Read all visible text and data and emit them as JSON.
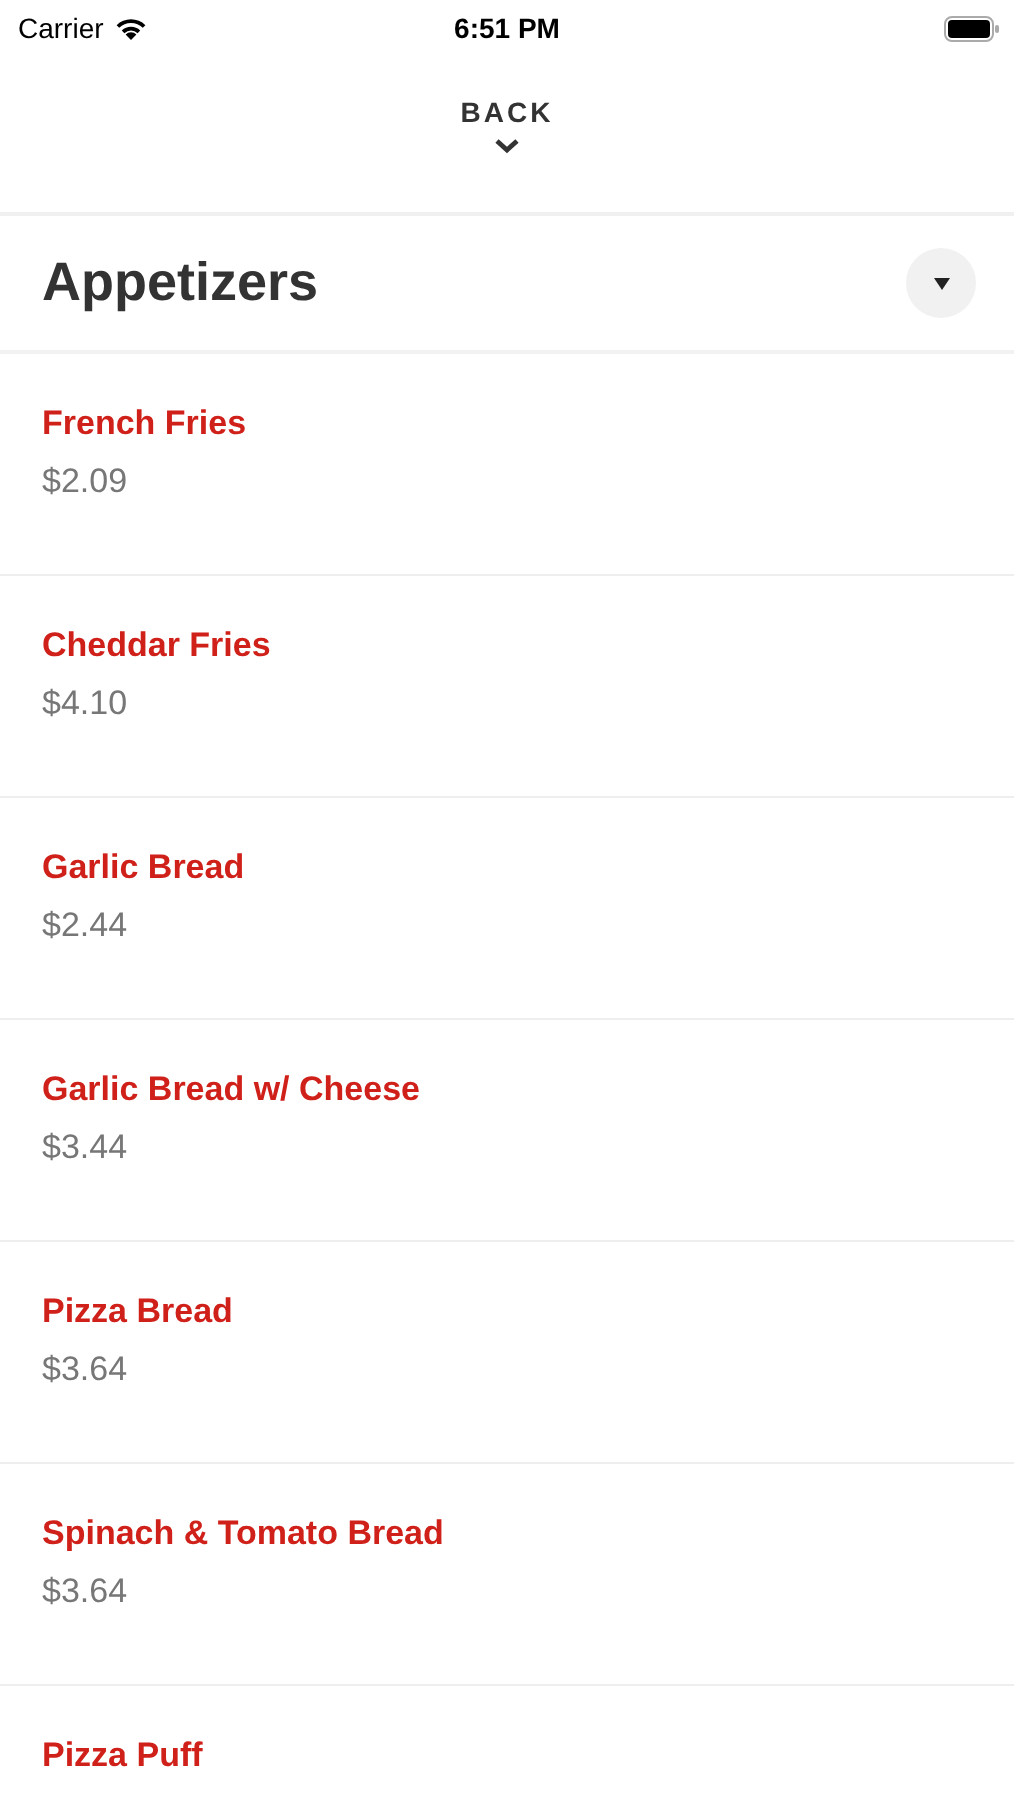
{
  "status_bar": {
    "carrier": "Carrier",
    "time": "6:51 PM"
  },
  "nav": {
    "back_label": "BACK"
  },
  "section": {
    "title": "Appetizers",
    "expanded": true
  },
  "items": [
    {
      "name": "French Fries",
      "price": "$2.09"
    },
    {
      "name": "Cheddar Fries",
      "price": "$4.10"
    },
    {
      "name": "Garlic Bread",
      "price": "$2.44"
    },
    {
      "name": "Garlic Bread w/ Cheese",
      "price": "$3.44"
    },
    {
      "name": "Pizza Bread",
      "price": "$3.64"
    },
    {
      "name": "Spinach & Tomato Bread",
      "price": "$3.64"
    },
    {
      "name": "Pizza Puff"
    }
  ]
}
